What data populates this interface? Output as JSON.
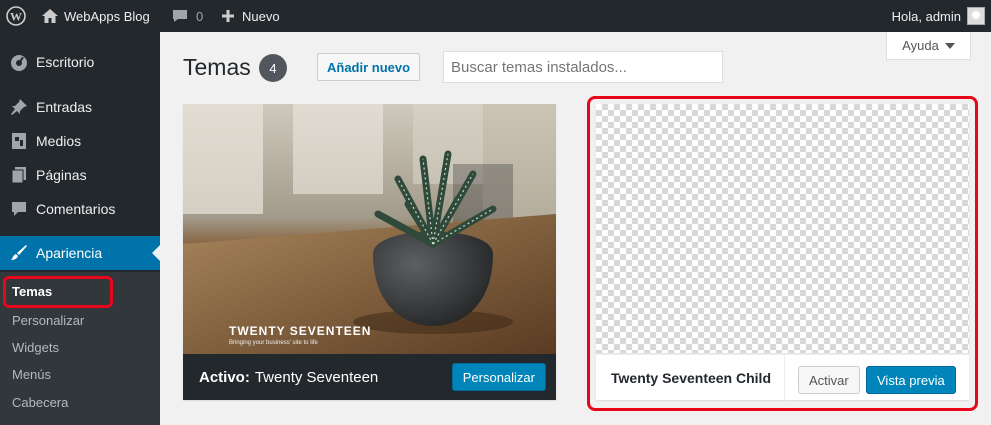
{
  "adminbar": {
    "site_name": "WebApps Blog",
    "comments_count": "0",
    "new_label": "Nuevo",
    "greeting": "Hola, admin"
  },
  "sidebar": {
    "items": [
      {
        "label": "Escritorio",
        "icon": "dashboard-icon"
      },
      {
        "label": "Entradas",
        "icon": "pin-icon"
      },
      {
        "label": "Medios",
        "icon": "media-icon"
      },
      {
        "label": "Páginas",
        "icon": "pages-icon"
      },
      {
        "label": "Comentarios",
        "icon": "comment-icon"
      },
      {
        "label": "Apariencia",
        "icon": "brush-icon"
      }
    ],
    "submenu": [
      "Temas",
      "Personalizar",
      "Widgets",
      "Menús",
      "Cabecera"
    ]
  },
  "header": {
    "title": "Temas",
    "count": "4",
    "add_new": "Añadir nuevo",
    "search_placeholder": "Buscar temas instalados...",
    "help": "Ayuda"
  },
  "themes": {
    "active": {
      "shot_title": "TWENTY SEVENTEEN",
      "shot_tagline": "Bringing your business' site to life",
      "prefix": "Activo:",
      "name": "Twenty Seventeen",
      "customize": "Personalizar"
    },
    "child": {
      "name": "Twenty Seventeen Child",
      "activate": "Activar",
      "preview": "Vista previa"
    }
  },
  "colors": {
    "accent": "#0073aa",
    "highlight": "#e8071a",
    "dark": "#23282d"
  }
}
